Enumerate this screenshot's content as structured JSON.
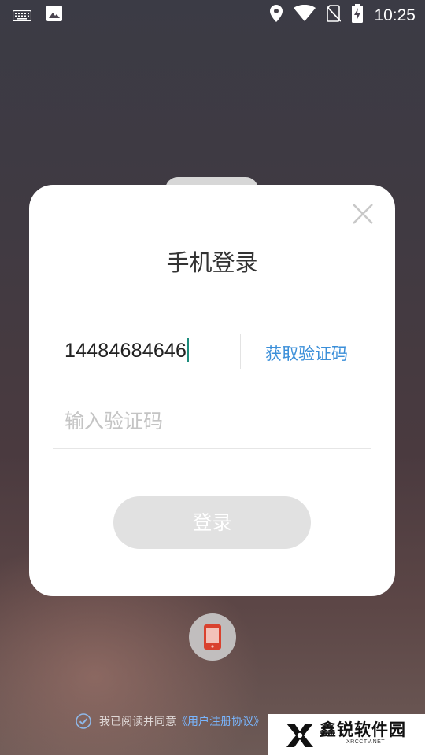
{
  "status_bar": {
    "time": "10:25",
    "icons": [
      "keyboard-icon",
      "image-icon",
      "location-icon",
      "wifi-icon",
      "no-sim-icon",
      "battery-charging-icon"
    ]
  },
  "dialog": {
    "title": "手机登录",
    "phone_value": "14484684646",
    "get_code_label": "获取验证码",
    "code_placeholder": "输入验证码",
    "login_label": "登录"
  },
  "agreement": {
    "text": "我已阅读并同意",
    "link": "《用户注册协议》"
  },
  "watermark": {
    "name": "鑫锐软件园",
    "sub": "XRCCTV.NET"
  },
  "colors": {
    "link_blue": "#3b8fd9",
    "caret": "#1c8c7c",
    "button_disabled": "#e1e1e1"
  }
}
